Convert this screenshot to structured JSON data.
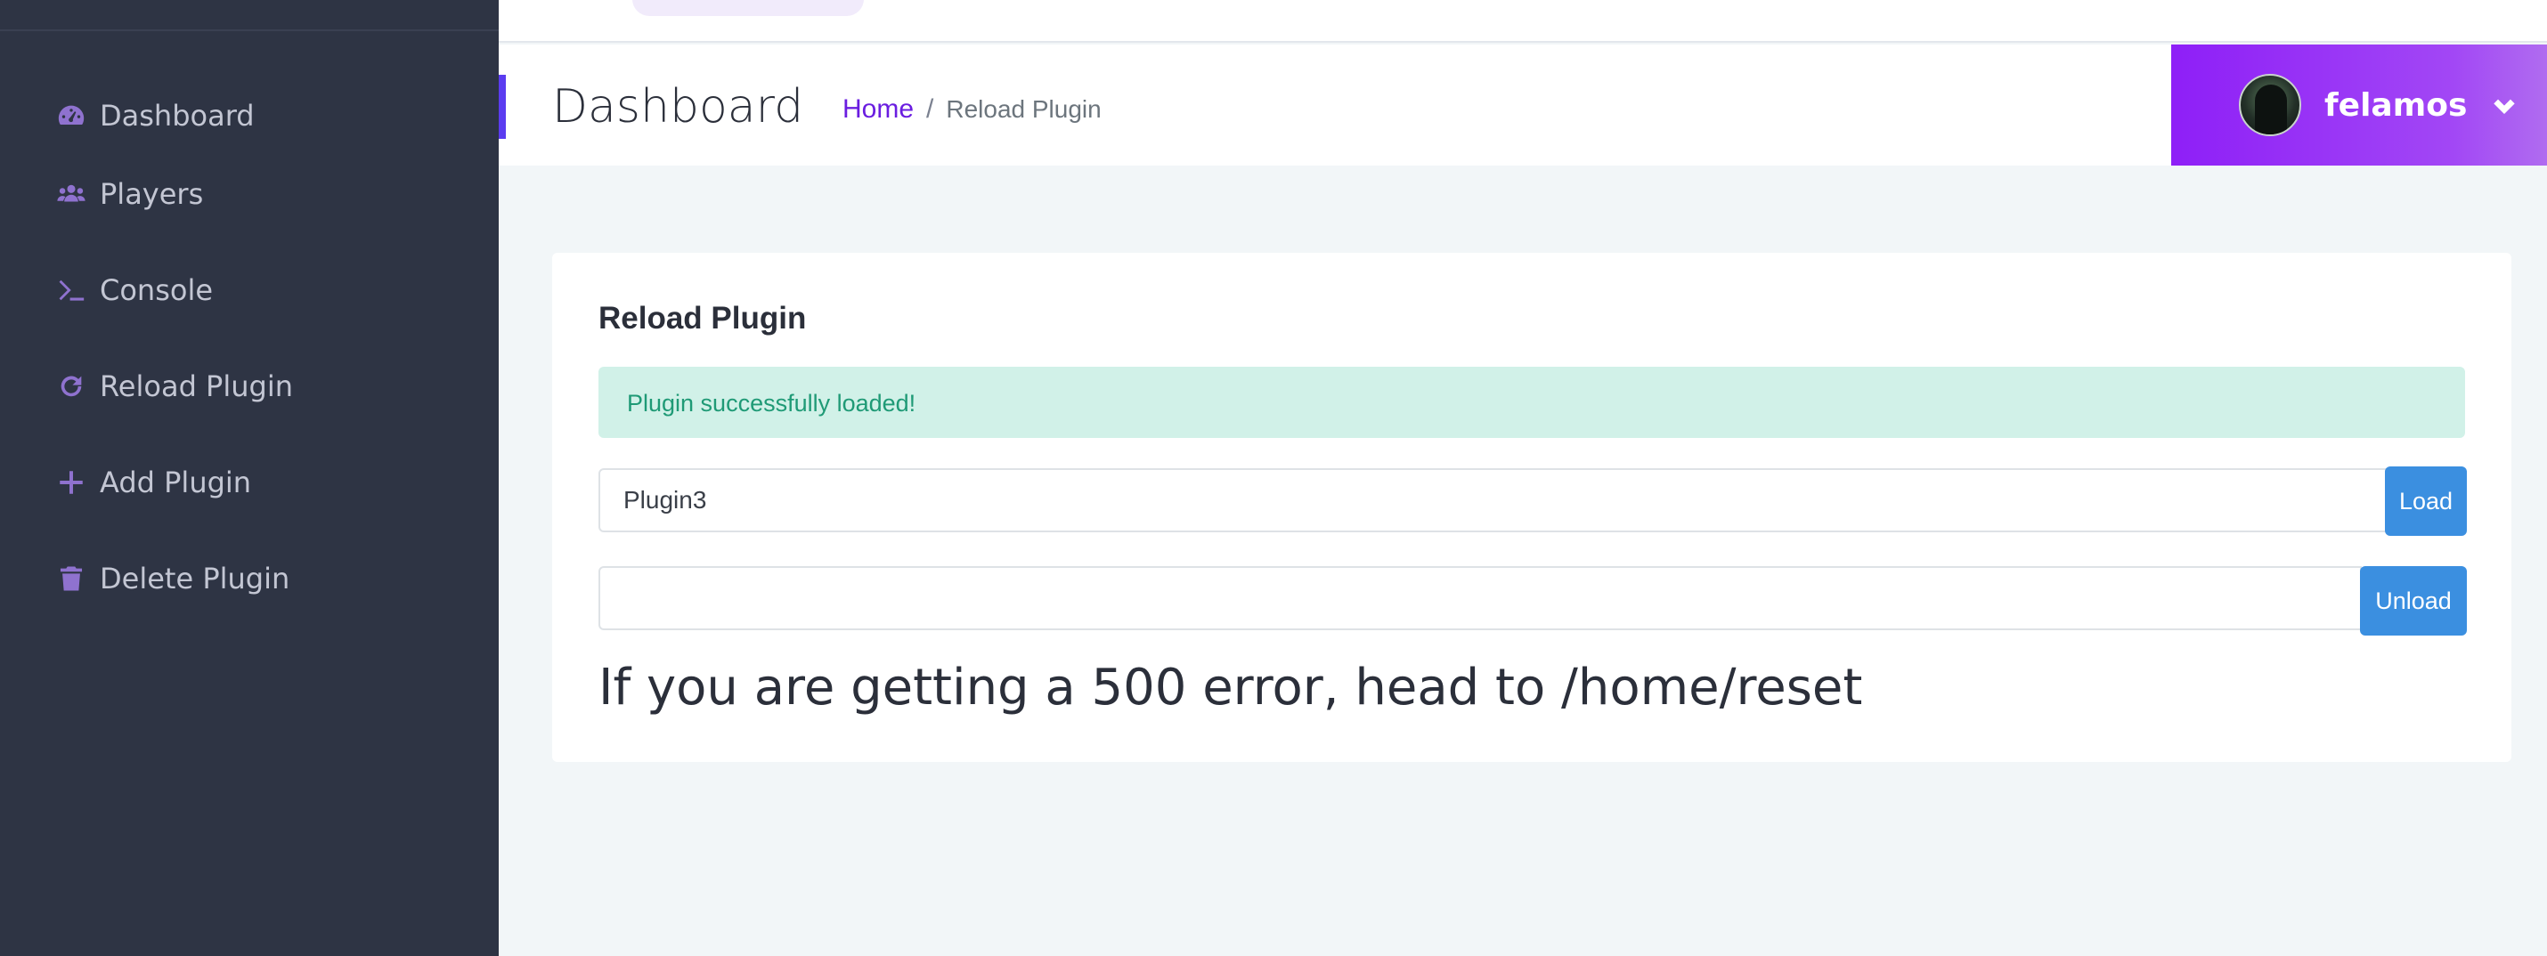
{
  "sidebar": {
    "items": [
      {
        "label": "Dashboard",
        "icon": "gauge-icon"
      },
      {
        "label": "Players",
        "icon": "users-icon"
      },
      {
        "label": "Console",
        "icon": "terminal-icon"
      },
      {
        "label": "Reload Plugin",
        "icon": "reload-icon"
      },
      {
        "label": "Add Plugin",
        "icon": "plus-icon"
      },
      {
        "label": "Delete Plugin",
        "icon": "trash-icon"
      }
    ]
  },
  "header": {
    "title": "Dashboard",
    "breadcrumb": {
      "home": "Home",
      "separator": "/",
      "current": "Reload Plugin"
    },
    "user": {
      "name": "felamos"
    }
  },
  "card": {
    "title": "Reload Plugin",
    "alert": "Plugin successfully loaded!",
    "load_input_value": "Plugin3",
    "load_button": "Load",
    "unload_input_value": "",
    "unload_button": "Unload",
    "note": "If you are getting a 500 error, head to /home/reset"
  },
  "colors": {
    "sidebar_bg": "#2e3444",
    "accent_purple": "#8e1ff7",
    "button_blue": "#3b8fe0",
    "alert_bg": "#d1f1e8",
    "alert_text": "#1f9a76"
  }
}
